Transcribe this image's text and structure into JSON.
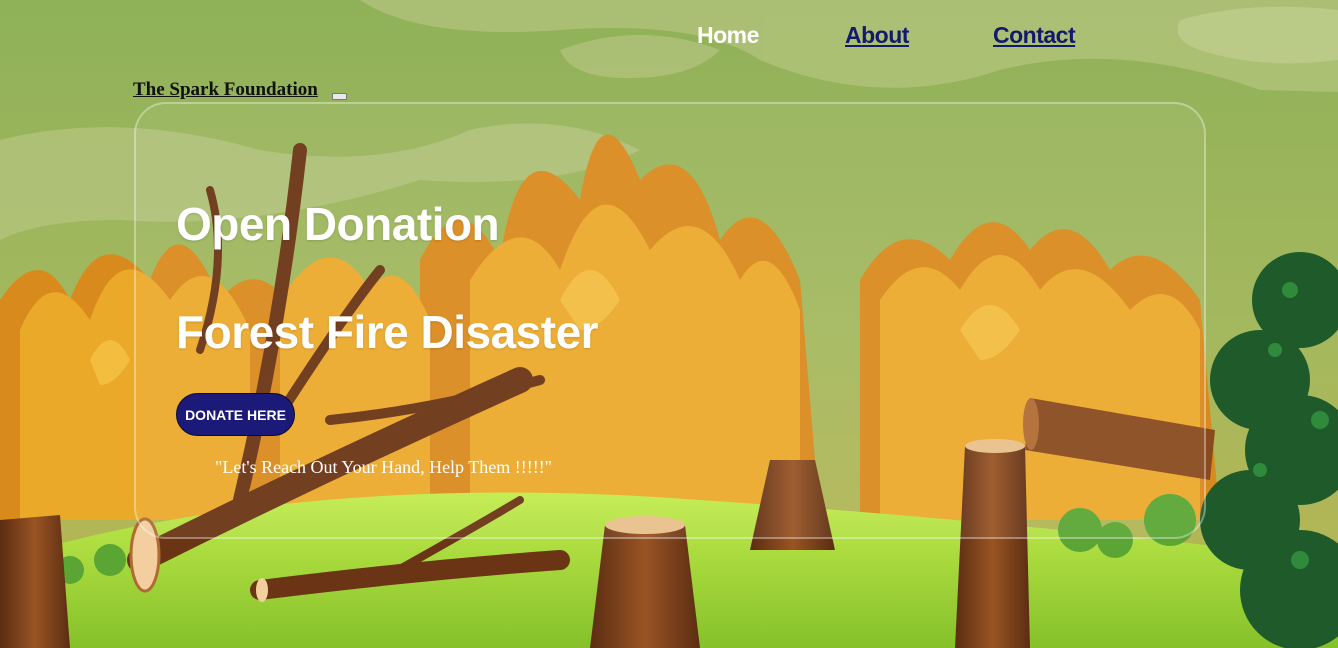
{
  "nav": {
    "home_label": "Home",
    "about_label": "About",
    "contact_label": "Contact"
  },
  "brand": {
    "name": "The Spark Foundation"
  },
  "hero": {
    "title_line1": "Open Donation",
    "title_line2": "Forest Fire Disaster",
    "donate_button": "DONATE HERE",
    "tagline": "\"Let's Reach Out Your Hand, Help Them !!!!!\""
  },
  "colors": {
    "nav_link": "#141a6b",
    "button_bg": "#1c1a78",
    "fire_orange": "#e8a526",
    "grass_green": "#a7d83a",
    "sky_green": "#9bb65b"
  },
  "background": {
    "icon": "forest-fire-illustration"
  }
}
